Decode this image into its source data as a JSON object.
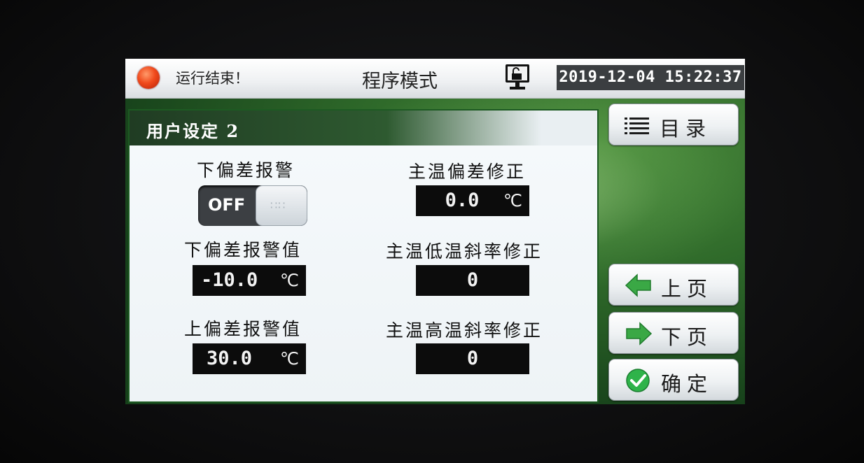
{
  "status_bar": {
    "run_status": "运行结束！",
    "mode_title": "程序模式",
    "datetime": "2019-12-04  15:22:37"
  },
  "panel": {
    "title": "用户设定 2",
    "left_column": {
      "lower_dev_alarm": {
        "label": "下偏差报警",
        "toggle_state": "OFF"
      },
      "lower_dev_alarm_value": {
        "label": "下偏差报警值",
        "value": "-10.0",
        "unit": "℃"
      },
      "upper_dev_alarm_value": {
        "label": "上偏差报警值",
        "value": "30.0",
        "unit": "℃"
      }
    },
    "right_column": {
      "main_temp_dev_correction": {
        "label": "主温偏差修正",
        "value": "0.0",
        "unit": "℃"
      },
      "main_temp_low_slope_correction": {
        "label": "主温低温斜率修正",
        "value": "0"
      },
      "main_temp_high_slope_correction": {
        "label": "主温高温斜率修正",
        "value": "0"
      }
    }
  },
  "side_buttons": {
    "menu": "目录",
    "prev_page": "上页",
    "next_page": "下页",
    "confirm": "确定"
  },
  "icons": {
    "alarm": "red-status-led",
    "lock": "unlocked-padlock-icon",
    "menu": "list-icon",
    "prev": "left-arrow-icon",
    "next": "right-arrow-icon",
    "confirm": "check-circle-icon"
  },
  "colors": {
    "alarm_led": "#f04a1c",
    "arrow_green": "#3aa845",
    "check_green": "#2fb34a",
    "value_bg": "#0c0c0c"
  }
}
